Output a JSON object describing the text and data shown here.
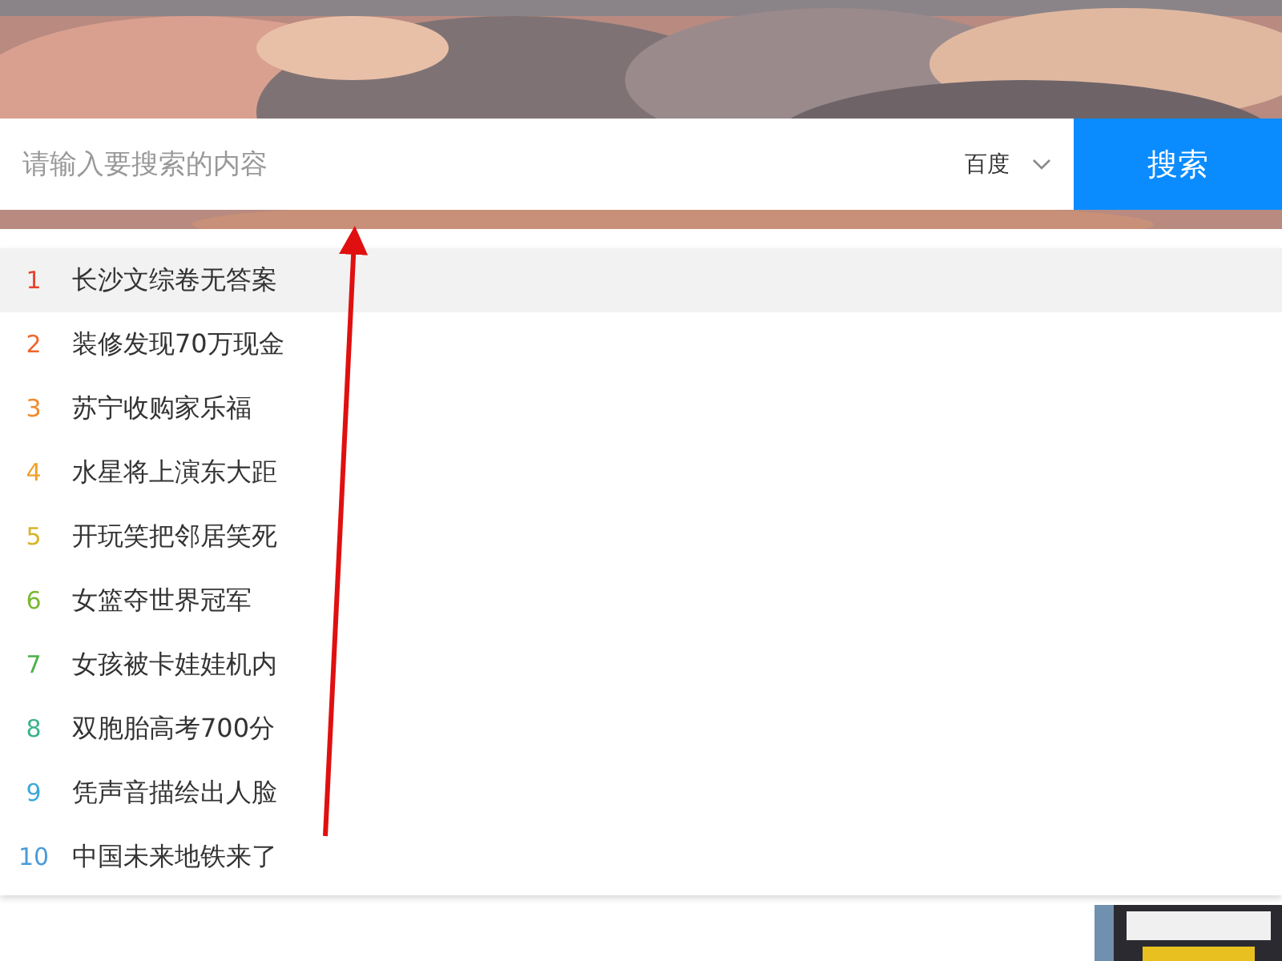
{
  "search": {
    "placeholder": "请输入要搜索的内容",
    "engine": "百度",
    "button": "搜索"
  },
  "suggestions": [
    {
      "rank": "1",
      "text": "长沙文综卷无答案",
      "color": "#e8442e",
      "selected": true
    },
    {
      "rank": "2",
      "text": "装修发现70万现金",
      "color": "#f0662c",
      "selected": false
    },
    {
      "rank": "3",
      "text": "苏宁收购家乐福",
      "color": "#f08a2c",
      "selected": false
    },
    {
      "rank": "4",
      "text": "水星将上演东大距",
      "color": "#f0a12c",
      "selected": false
    },
    {
      "rank": "5",
      "text": "开玩笑把邻居笑死",
      "color": "#d8b42c",
      "selected": false
    },
    {
      "rank": "6",
      "text": "女篮夺世界冠军",
      "color": "#7ab830",
      "selected": false
    },
    {
      "rank": "7",
      "text": "女孩被卡娃娃机内",
      "color": "#4cb04a",
      "selected": false
    },
    {
      "rank": "8",
      "text": "双胞胎高考700分",
      "color": "#3cb48a",
      "selected": false
    },
    {
      "rank": "9",
      "text": "凭声音描绘出人脸",
      "color": "#3aa8d8",
      "selected": false
    },
    {
      "rank": "10",
      "text": "中国未来地铁来了",
      "color": "#4a9ad8",
      "selected": false
    }
  ]
}
